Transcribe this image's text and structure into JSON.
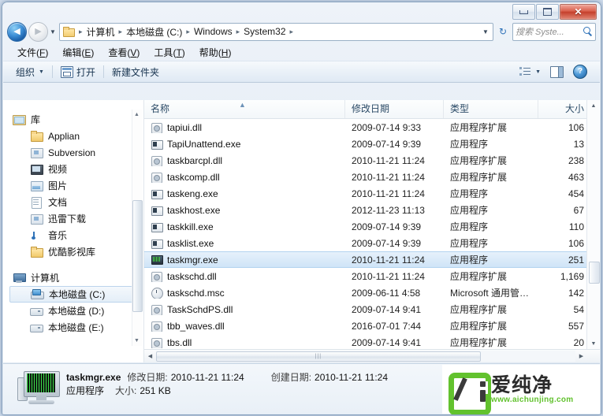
{
  "window": {
    "minimize_label": "−",
    "maximize_label": "□",
    "close_label": "✕"
  },
  "nav": {
    "back_icon": "◀",
    "forward_icon": "▶",
    "history_caret": "▼",
    "breadcrumbs": [
      "计算机",
      "本地磁盘 (C:)",
      "Windows",
      "System32"
    ],
    "separator": "▸",
    "dropdown_caret": "▼",
    "refresh_icon": "↻"
  },
  "search": {
    "placeholder": "搜索 Syste...",
    "icon": "search-icon"
  },
  "menu": {
    "items": [
      {
        "text": "文件",
        "key": "F"
      },
      {
        "text": "编辑",
        "key": "E"
      },
      {
        "text": "查看",
        "key": "V"
      },
      {
        "text": "工具",
        "key": "T"
      },
      {
        "text": "帮助",
        "key": "H"
      }
    ]
  },
  "toolbar": {
    "organize_label": "组织",
    "organize_caret": "▼",
    "open_label": "打开",
    "new_folder_label": "新建文件夹",
    "view_caret": "▼"
  },
  "sidebar": {
    "items": [
      {
        "label": "库",
        "icon": "library-icon",
        "level": 0,
        "selected": false
      },
      {
        "label": "Applian",
        "icon": "folder-icon",
        "level": 1,
        "selected": false
      },
      {
        "label": "Subversion",
        "icon": "download-icon",
        "level": 1,
        "selected": false
      },
      {
        "label": "视频",
        "icon": "video-icon",
        "level": 1,
        "selected": false
      },
      {
        "label": "图片",
        "icon": "picture-icon",
        "level": 1,
        "selected": false
      },
      {
        "label": "文档",
        "icon": "document-icon",
        "level": 1,
        "selected": false
      },
      {
        "label": "迅雷下载",
        "icon": "download-icon",
        "level": 1,
        "selected": false
      },
      {
        "label": "音乐",
        "icon": "music-icon",
        "level": 1,
        "selected": false
      },
      {
        "label": "优酷影视库",
        "icon": "folder-icon",
        "level": 1,
        "selected": false
      },
      {
        "label": "计算机",
        "icon": "computer-icon",
        "level": 0,
        "selected": false
      },
      {
        "label": "本地磁盘 (C:)",
        "icon": "drive-system-icon",
        "level": 1,
        "selected": true
      },
      {
        "label": "本地磁盘 (D:)",
        "icon": "drive-icon",
        "level": 1,
        "selected": false
      },
      {
        "label": "本地磁盘 (E:)",
        "icon": "drive-icon",
        "level": 1,
        "selected": false
      }
    ],
    "scroll_up": "▲",
    "scroll_down": "▼"
  },
  "filelist": {
    "columns": [
      "名称",
      "修改日期",
      "类型",
      "大小"
    ],
    "sort_indicator": "▲",
    "rows": [
      {
        "name": "tapiui.dll",
        "date": "2009-07-14 9:33",
        "type": "应用程序扩展",
        "size": "106",
        "icon": "dll-icon",
        "selected": false
      },
      {
        "name": "TapiUnattend.exe",
        "date": "2009-07-14 9:39",
        "type": "应用程序",
        "size": "13",
        "icon": "exe-icon",
        "selected": false
      },
      {
        "name": "taskbarcpl.dll",
        "date": "2010-11-21 11:24",
        "type": "应用程序扩展",
        "size": "238",
        "icon": "dll-icon",
        "selected": false
      },
      {
        "name": "taskcomp.dll",
        "date": "2010-11-21 11:24",
        "type": "应用程序扩展",
        "size": "463",
        "icon": "dll-icon",
        "selected": false
      },
      {
        "name": "taskeng.exe",
        "date": "2010-11-21 11:24",
        "type": "应用程序",
        "size": "454",
        "icon": "exe-icon",
        "selected": false
      },
      {
        "name": "taskhost.exe",
        "date": "2012-11-23 11:13",
        "type": "应用程序",
        "size": "67",
        "icon": "exe-icon",
        "selected": false
      },
      {
        "name": "taskkill.exe",
        "date": "2009-07-14 9:39",
        "type": "应用程序",
        "size": "110",
        "icon": "exe-icon",
        "selected": false
      },
      {
        "name": "tasklist.exe",
        "date": "2009-07-14 9:39",
        "type": "应用程序",
        "size": "106",
        "icon": "exe-icon",
        "selected": false
      },
      {
        "name": "taskmgr.exe",
        "date": "2010-11-21 11:24",
        "type": "应用程序",
        "size": "251",
        "icon": "taskmgr-icon",
        "selected": true
      },
      {
        "name": "taskschd.dll",
        "date": "2010-11-21 11:24",
        "type": "应用程序扩展",
        "size": "1,169",
        "icon": "dll-icon",
        "selected": false
      },
      {
        "name": "taskschd.msc",
        "date": "2009-06-11 4:58",
        "type": "Microsoft 通用管…",
        "size": "142",
        "icon": "msc-icon",
        "selected": false
      },
      {
        "name": "TaskSchdPS.dll",
        "date": "2009-07-14 9:41",
        "type": "应用程序扩展",
        "size": "54",
        "icon": "dll-icon",
        "selected": false
      },
      {
        "name": "tbb_waves.dll",
        "date": "2016-07-01 7:44",
        "type": "应用程序扩展",
        "size": "557",
        "icon": "dll-icon",
        "selected": false
      },
      {
        "name": "tbs.dll",
        "date": "2009-07-14 9:41",
        "type": "应用程序扩展",
        "size": "20",
        "icon": "dll-icon",
        "selected": false
      }
    ],
    "h_left_arrow": "◀",
    "h_right_arrow": "▶",
    "v_up_arrow": "▲",
    "v_down_arrow": "▼",
    "grip": "|||"
  },
  "details": {
    "filename": "taskmgr.exe",
    "modified_label": "修改日期:",
    "modified_value": "2010-11-21 11:24",
    "created_label": "创建日期:",
    "created_value": "2010-11-21 11:24",
    "type_value": "应用程序",
    "size_label": "大小:",
    "size_value": "251 KB"
  },
  "watermark": {
    "brand": "爱纯净",
    "url": "www.aichunjing.com",
    "accent": "#62c22e"
  }
}
